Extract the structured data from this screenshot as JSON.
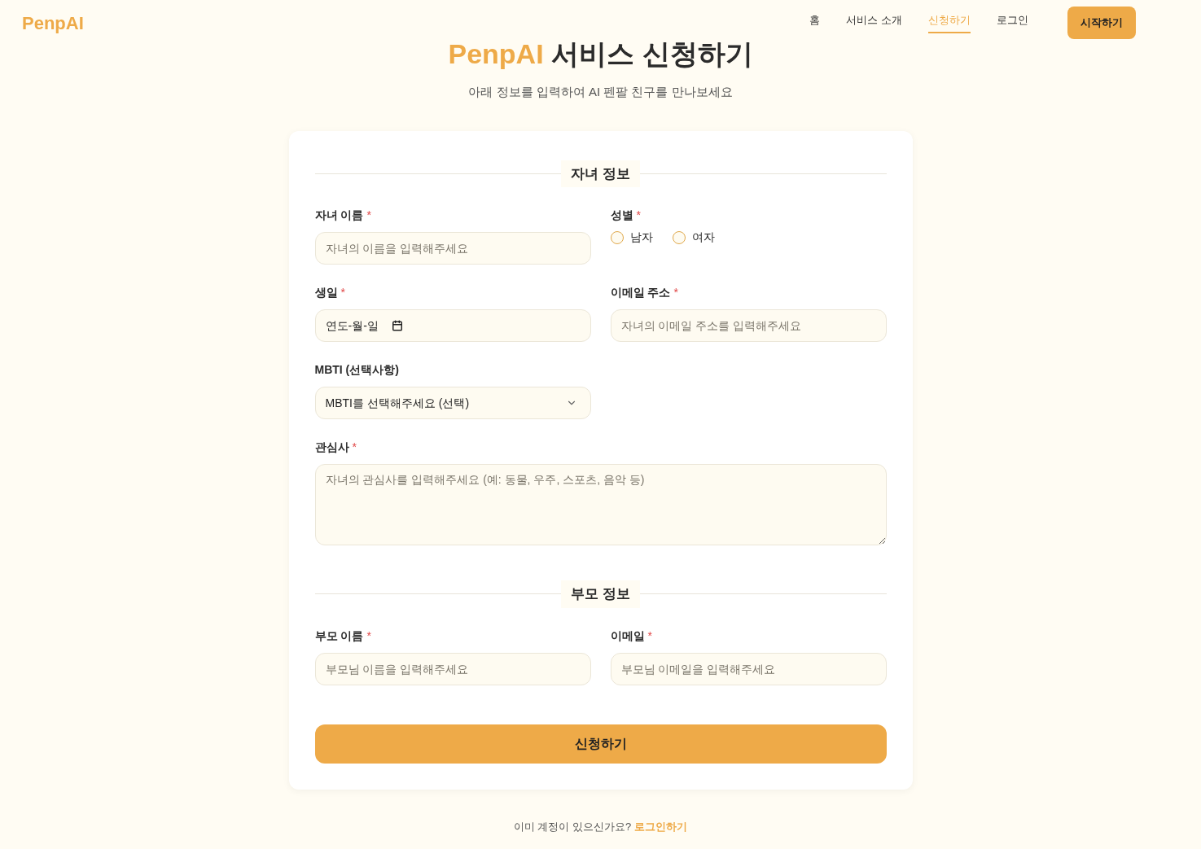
{
  "header": {
    "logo": "PenpAI",
    "nav": [
      {
        "label": "홈",
        "selected": false
      },
      {
        "label": "서비스 소개",
        "selected": false
      },
      {
        "label": "신청하기",
        "selected": true
      },
      {
        "label": "로그인",
        "selected": false
      }
    ],
    "cta": "시작하기"
  },
  "hero": {
    "title_brand": "PenpAI",
    "title_rest": "서비스 신청하기",
    "subtitle": "아래 정보를 입력하여 AI 펜팔 친구를 만나보세요"
  },
  "sections": [
    {
      "title": "자녀 정보",
      "rows": [
        [
          {
            "kind": "text",
            "label": "자녀 이름",
            "required": "*",
            "placeholder": "자녀의 이름을 입력해주세요"
          },
          {
            "kind": "radio",
            "label": "성별",
            "required": "*",
            "options": [
              {
                "label": "남자",
                "selected": false
              },
              {
                "label": "여자",
                "selected": false
              }
            ]
          }
        ],
        [
          {
            "kind": "date",
            "label": "생일",
            "required": "*",
            "value": "연도-월-일"
          },
          {
            "kind": "text",
            "label": "이메일 주소",
            "required": "*",
            "placeholder": "자녀의 이메일 주소를 입력해주세요"
          }
        ],
        [
          {
            "kind": "select",
            "label": "MBTI (선택사항)",
            "value": "MBTI를 선택해주세요 (선택)"
          }
        ],
        [
          {
            "kind": "textarea",
            "label": "관심사",
            "required": "*",
            "placeholder": "자녀의 관심사를 입력해주세요 (예: 동물, 우주, 스포츠, 음악 등)"
          }
        ]
      ]
    },
    {
      "title": "부모 정보",
      "rows": [
        [
          {
            "kind": "text",
            "label": "부모 이름",
            "required": "*",
            "placeholder": "부모님 이름을 입력해주세요"
          },
          {
            "kind": "text",
            "label": "이메일",
            "required": "*",
            "placeholder": "부모님 이메일을 입력해주세요"
          }
        ]
      ]
    }
  ],
  "submit": "신청하기",
  "footer": {
    "text": "이미 계정이 있으신가요?",
    "link": "로그인하기"
  }
}
